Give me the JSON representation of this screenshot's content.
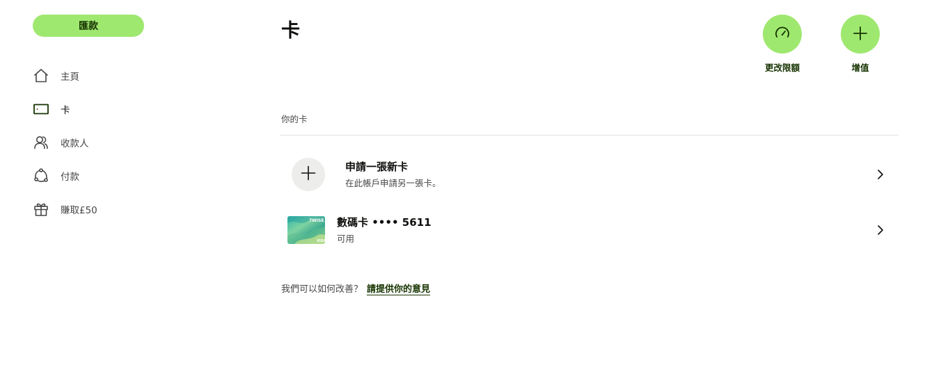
{
  "sidebar": {
    "send_label": "匯款",
    "items": [
      {
        "label": "主頁",
        "icon": "home-icon"
      },
      {
        "label": "卡",
        "icon": "card-icon"
      },
      {
        "label": "收款人",
        "icon": "recipients-icon"
      },
      {
        "label": "付款",
        "icon": "payments-icon"
      },
      {
        "label": "賺取£50",
        "icon": "gift-icon"
      }
    ]
  },
  "main": {
    "title": "卡",
    "actions": [
      {
        "label": "更改限額",
        "icon": "speedometer-icon"
      },
      {
        "label": "增值",
        "icon": "plus-icon"
      }
    ],
    "section_title": "你的卡",
    "rows": [
      {
        "title": "申請一張新卡",
        "subtitle": "在此帳戶申請另一張卡。",
        "icon": "plus-icon"
      },
      {
        "title": "數碼卡 •••• 5611",
        "subtitle": "可用",
        "card_brand": "wise",
        "card_network": "VISA"
      }
    ],
    "feedback": {
      "prompt": "我們可以如何改善？",
      "link": "請提供你的意見"
    }
  },
  "colors": {
    "accent": "#9fe870",
    "accent_text": "#163300",
    "text": "#0e0f0c",
    "muted": "#454745",
    "divider": "#e0e0e0"
  }
}
